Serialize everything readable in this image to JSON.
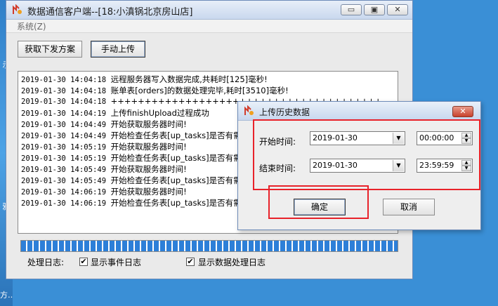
{
  "desktop": {
    "labels": [
      "示",
      "鸦",
      "方…"
    ]
  },
  "window": {
    "title": "数据通信客户端--[18:小滇锅北京房山店]",
    "controls": {
      "minimize": "▭",
      "restore": "▣",
      "close": "✕"
    }
  },
  "menu": {
    "system": "系统(Z)"
  },
  "toolbar": {
    "fetch_plan": "获取下发方案",
    "manual_upload": "手动上传"
  },
  "log": {
    "lines": [
      {
        "time": "2019-01-30 14:04:18",
        "msg": "远程服务器写入数据完成,共耗时[125]毫秒!"
      },
      {
        "time": "2019-01-30 14:04:18",
        "msg": "账单表[orders]的数据处理完毕,耗时[3510]毫秒!"
      },
      {
        "time": "2019-01-30 14:04:18",
        "msg": "++++++++++++++++++++++++++++++++++++++++"
      },
      {
        "time": "2019-01-30 14:04:19",
        "msg": "上传finishUpload过程成功"
      },
      {
        "time": "2019-01-30 14:04:49",
        "msg": "开始获取服务器时间!"
      },
      {
        "time": "2019-01-30 14:04:49",
        "msg": "开始检查任务表[up_tasks]是否有需"
      },
      {
        "time": "2019-01-30 14:05:19",
        "msg": "开始获取服务器时间!"
      },
      {
        "time": "2019-01-30 14:05:19",
        "msg": "开始检查任务表[up_tasks]是否有需"
      },
      {
        "time": "2019-01-30 14:05:49",
        "msg": "开始获取服务器时间!"
      },
      {
        "time": "2019-01-30 14:05:49",
        "msg": "开始检查任务表[up_tasks]是否有需"
      },
      {
        "time": "2019-01-30 14:06:19",
        "msg": "开始获取服务器时间!"
      },
      {
        "time": "2019-01-30 14:06:19",
        "msg": "开始检查任务表[up_tasks]是否有需"
      }
    ]
  },
  "progress": {
    "fraction": 1.0,
    "color": "#2d7fd8"
  },
  "footer": {
    "log_label": "处理日志:",
    "show_event_log": {
      "label": "显示事件日志",
      "checked": "✔"
    },
    "show_data_log": {
      "label": "显示数据处理日志",
      "checked": "✔"
    }
  },
  "dialog": {
    "title": "上传历史数据",
    "close": "✕",
    "start_label": "开始时间:",
    "start_date": "2019-01-30",
    "start_time": "00:00:00",
    "end_label": "结束时间:",
    "end_date": "2019-01-30",
    "end_time": "23:59:59",
    "ok": "确定",
    "cancel": "取消"
  },
  "colors": {
    "highlight_box": "#e8222a"
  }
}
